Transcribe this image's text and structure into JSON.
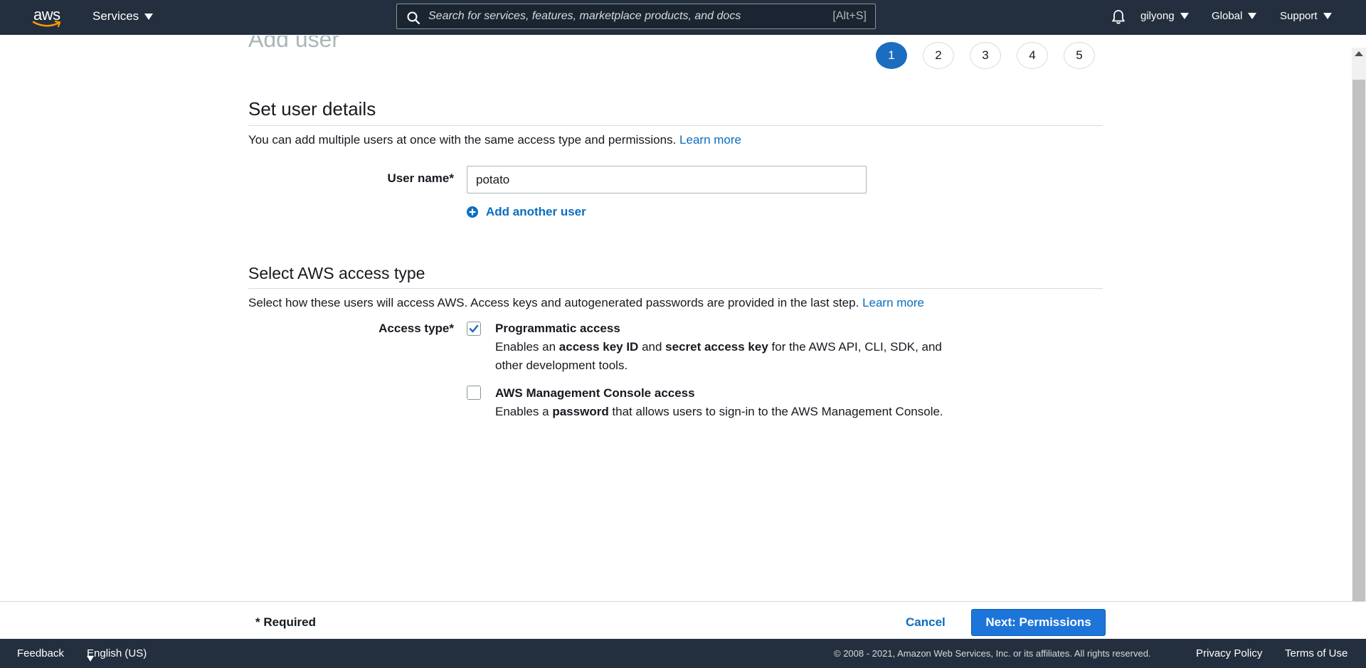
{
  "nav": {
    "logo": "aws",
    "services_label": "Services",
    "search_placeholder": "Search for services, features, marketplace products, and docs",
    "search_shortcut": "[Alt+S]",
    "user": "gilyong",
    "region": "Global",
    "support": "Support"
  },
  "page": {
    "title": "Add user",
    "steps": [
      "1",
      "2",
      "3",
      "4",
      "5"
    ],
    "active_step": "1"
  },
  "user_details": {
    "title": "Set user details",
    "description": "You can add multiple users at once with the same access type and permissions.",
    "learn_more": "Learn more",
    "username_label": "User name*",
    "username_value": "potato",
    "add_another": "Add another user"
  },
  "access_type": {
    "title": "Select AWS access type",
    "description": "Select how these users will access AWS. Access keys and autogenerated passwords are provided in the last step.",
    "learn_more": "Learn more",
    "label": "Access type*",
    "options": [
      {
        "title": "Programmatic access",
        "checked": true,
        "desc_1": "Enables an ",
        "bold_1": "access key ID",
        "desc_2": " and ",
        "bold_2": "secret access key",
        "desc_3": " for the AWS API, CLI, SDK, and other development tools."
      },
      {
        "title": "AWS Management Console access",
        "checked": false,
        "desc_1": "Enables a ",
        "bold_1": "password",
        "desc_2": " that allows users to sign-in to the AWS Management Console."
      }
    ]
  },
  "actions": {
    "required_note": "* Required",
    "cancel": "Cancel",
    "next": "Next: Permissions"
  },
  "footer": {
    "feedback": "Feedback",
    "language": "English (US)",
    "copyright": "© 2008 - 2021, Amazon Web Services, Inc. or its affiliates. All rights reserved.",
    "privacy": "Privacy Policy",
    "terms": "Terms of Use"
  },
  "colors": {
    "nav_bg": "#232f3e",
    "link": "#0a6dbf",
    "primary_button": "#1e75d9",
    "active_step": "#1a6dbf"
  }
}
